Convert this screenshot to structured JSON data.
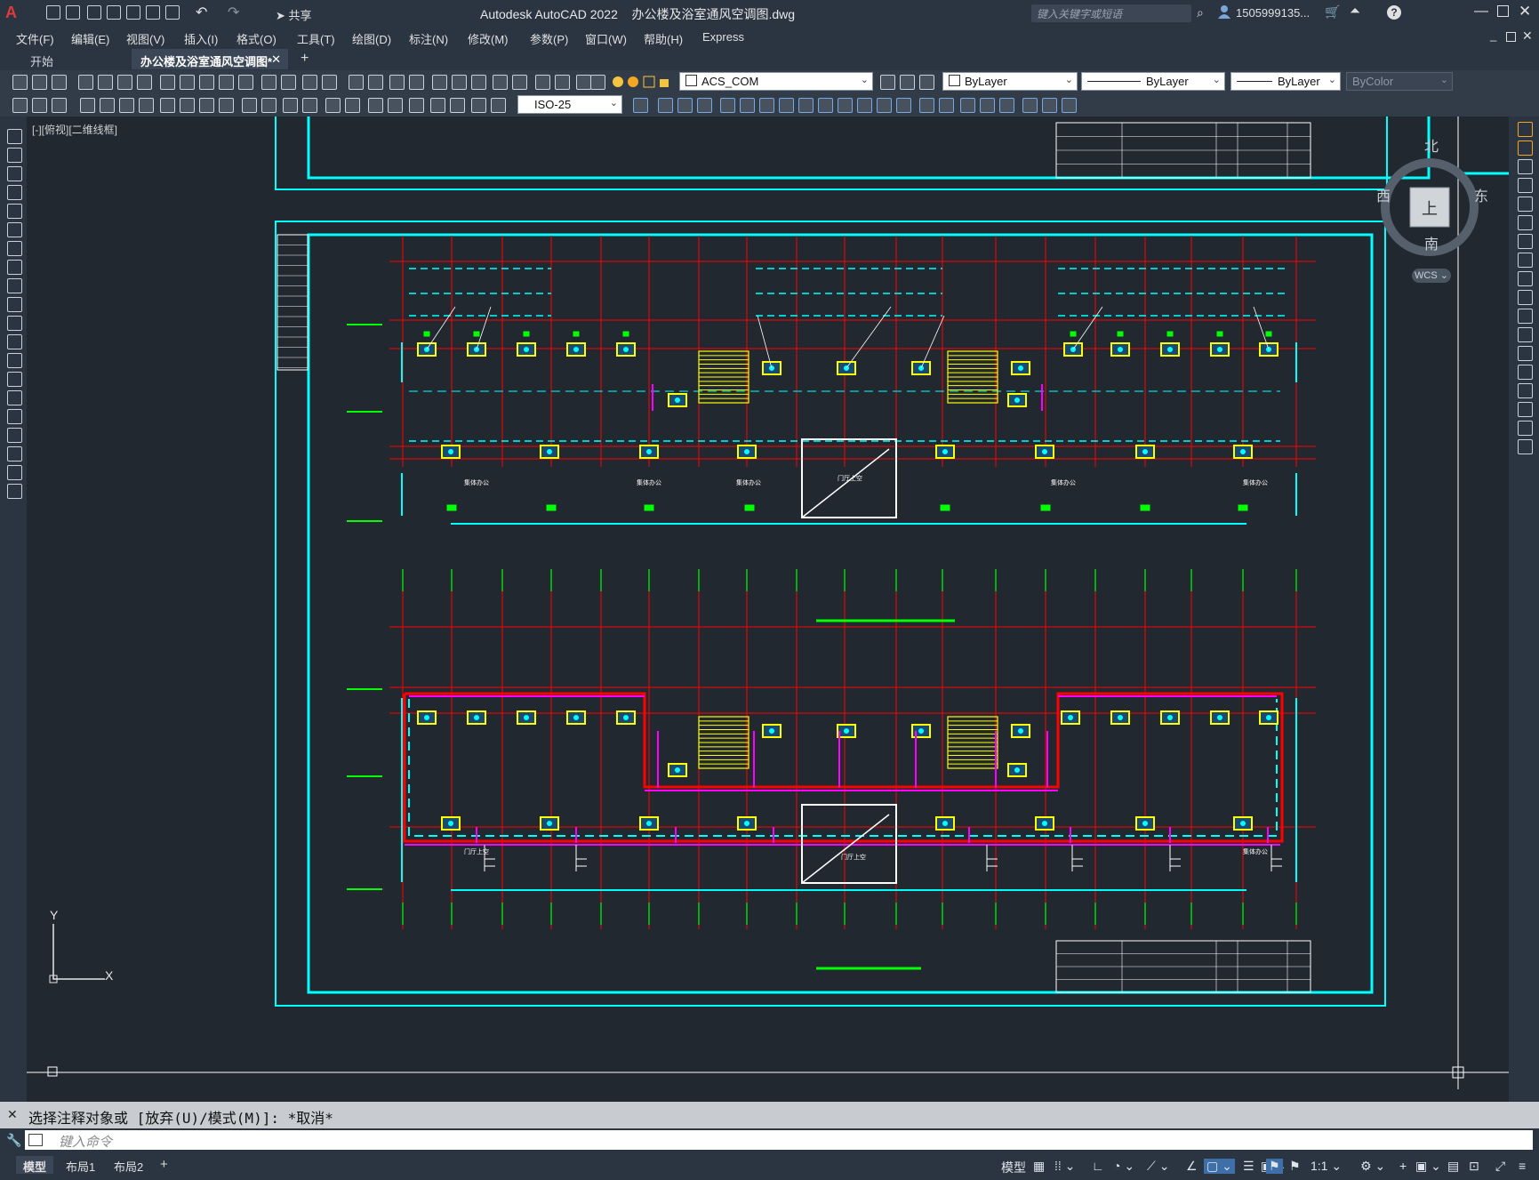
{
  "app": {
    "title": "Autodesk AutoCAD 2022",
    "document": "办公楼及浴室通风空调图.dwg",
    "share_label": "共享",
    "search_placeholder": "键入关键字或短语",
    "user": "1505999135...",
    "window_controls": [
      "minimize-icon",
      "maximize-icon",
      "close-icon"
    ]
  },
  "menu": [
    "文件(F)",
    "编辑(E)",
    "视图(V)",
    "插入(I)",
    "格式(O)",
    "工具(T)",
    "绘图(D)",
    "标注(N)",
    "修改(M)",
    "参数(P)",
    "窗口(W)",
    "帮助(H)",
    "Express"
  ],
  "tabs": [
    {
      "label": "开始",
      "active": false
    },
    {
      "label": "办公楼及浴室通风空调图*",
      "active": true
    }
  ],
  "toolbar": {
    "layer_combo": "ACS_COM",
    "color_combo": "ByLayer",
    "linetype_combo": "ByLayer",
    "lineweight_combo": "ByLayer",
    "plotstyle_combo": "ByColor",
    "dimstyle_combo": "ISO-25"
  },
  "viewport": {
    "label": "[-][俯视][二维线框]",
    "viewcube": {
      "north": "北",
      "south": "南",
      "east": "东",
      "west": "西",
      "top": "上",
      "wcs": "WCS"
    },
    "ucs": {
      "x": "X",
      "y": "Y"
    }
  },
  "drawing": {
    "room_labels": [
      "集体办公",
      "集体办公",
      "集体办公",
      "门厅上空",
      "集体办公",
      "集体办公",
      "门厅上空",
      "集体办公"
    ],
    "colors": {
      "frame": "#00ffff",
      "grid": "#ff0000",
      "gridmark": "#00ff00",
      "unit": "#ffff00",
      "duct": "#ff00ff",
      "white": "#ffffff"
    }
  },
  "command": {
    "history": "选择注释对象或 [放弃(U)/模式(M)]: *取消*",
    "placeholder": "键入命令"
  },
  "status": {
    "layouts": [
      "模型",
      "布局1",
      "布局2"
    ],
    "model_label": "模型",
    "scale": "1:1"
  }
}
